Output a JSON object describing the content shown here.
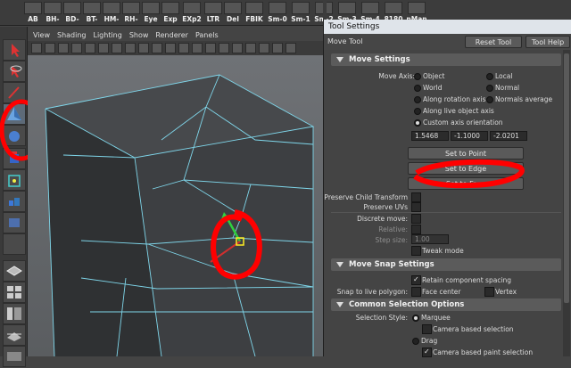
{
  "shelf": {
    "buttons": [
      "AB",
      "BH-",
      "BD-",
      "BT-",
      "HM-",
      "RH-",
      "Eye",
      "Exp",
      "EXp2",
      "LTR",
      "Del",
      "FBIK",
      "Sm-0",
      "Sm-1",
      "Sm-2",
      "Sm-3",
      "Sm-4",
      "8180",
      "nMan"
    ]
  },
  "toolbox": {
    "tools": [
      "select-tool",
      "lasso-tool",
      "paint-select-tool",
      "move-tool",
      "rotate-tool",
      "scale-tool",
      "universal-manipulator-tool",
      "soft-mod-tool",
      "show-manipulator-tool",
      "last-tool",
      "layout-single-pane",
      "layout-four-pane",
      "layout-outliner",
      "layout-graph",
      "layout-hypershade"
    ]
  },
  "viewport": {
    "menu": [
      "View",
      "Shading",
      "Lighting",
      "Show",
      "Renderer",
      "Panels"
    ],
    "scene_object": "cube-mesh"
  },
  "panel": {
    "title": "Tool Settings",
    "tool_name": "Move Tool",
    "reset_tool": "Reset Tool",
    "tool_help": "Tool Help",
    "move_settings": {
      "header": "Move Settings",
      "move_axis_label": "Move Axis:",
      "options": [
        {
          "label": "Object",
          "selected": false
        },
        {
          "label": "Local",
          "selected": false
        },
        {
          "label": "World",
          "selected": false
        },
        {
          "label": "Normal",
          "selected": false
        },
        {
          "label": "Along rotation axis",
          "selected": false
        },
        {
          "label": "Normals average",
          "selected": false
        },
        {
          "label": "Along live object axis",
          "selected": false
        },
        {
          "label": "Custom axis orientation",
          "selected": true
        }
      ],
      "custom_x": "1.5468",
      "custom_y": "-1.1000",
      "custom_z": "-2.0201",
      "set_to_point": "Set to Point",
      "set_to_edge": "Set to Edge",
      "set_to_face": "Set to Face",
      "preserve_child_transform": "Preserve Child Transform",
      "preserve_uvs": "Preserve UVs",
      "discrete_move": "Discrete move:",
      "relative": "Relative:",
      "step_size": "Step size:",
      "step_size_value": "1.00",
      "tweak_mode": "Tweak mode"
    },
    "move_snap_settings": {
      "header": "Move Snap Settings",
      "retain_component_spacing": "Retain component spacing",
      "retain_checked": true,
      "snap_to_live_polygon": "Snap to live polygon:",
      "face_center": "Face center",
      "vertex": "Vertex"
    },
    "common_selection": {
      "header": "Common Selection Options",
      "selection_style": "Selection Style:",
      "marquee": "Marquee",
      "camera_based_selection": "Camera based selection",
      "drag": "Drag",
      "camera_based_paint_selection": "Camera based paint selection",
      "camera_paint_checked": true
    }
  },
  "colors": {
    "annotation_red": "#ff0000",
    "wire_cyan": "#7fd6ea",
    "panel_bg": "#444444"
  }
}
